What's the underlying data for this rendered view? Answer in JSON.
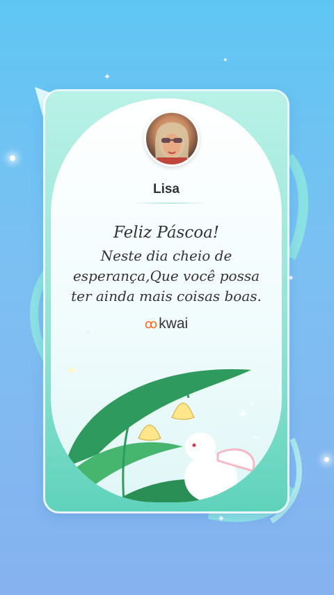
{
  "card": {
    "username": "Lisa",
    "avatar_alt": "profile photo",
    "greeting_title": "Feliz Páscoa!",
    "greeting_body": "Neste dia cheio de esperança,Que você possa ter ainda mais coisas boas.",
    "brand_name": "kwai",
    "brand_icon": "kwai-logo-icon"
  },
  "colors": {
    "background_top": "#5fc6f3",
    "background_bottom": "#86b2ef",
    "card_frame": "#8fe3d3",
    "leaf_green": "#3daf6a",
    "flower_yellow": "#ffe68a",
    "brand_orange": "#ff6a1a"
  }
}
